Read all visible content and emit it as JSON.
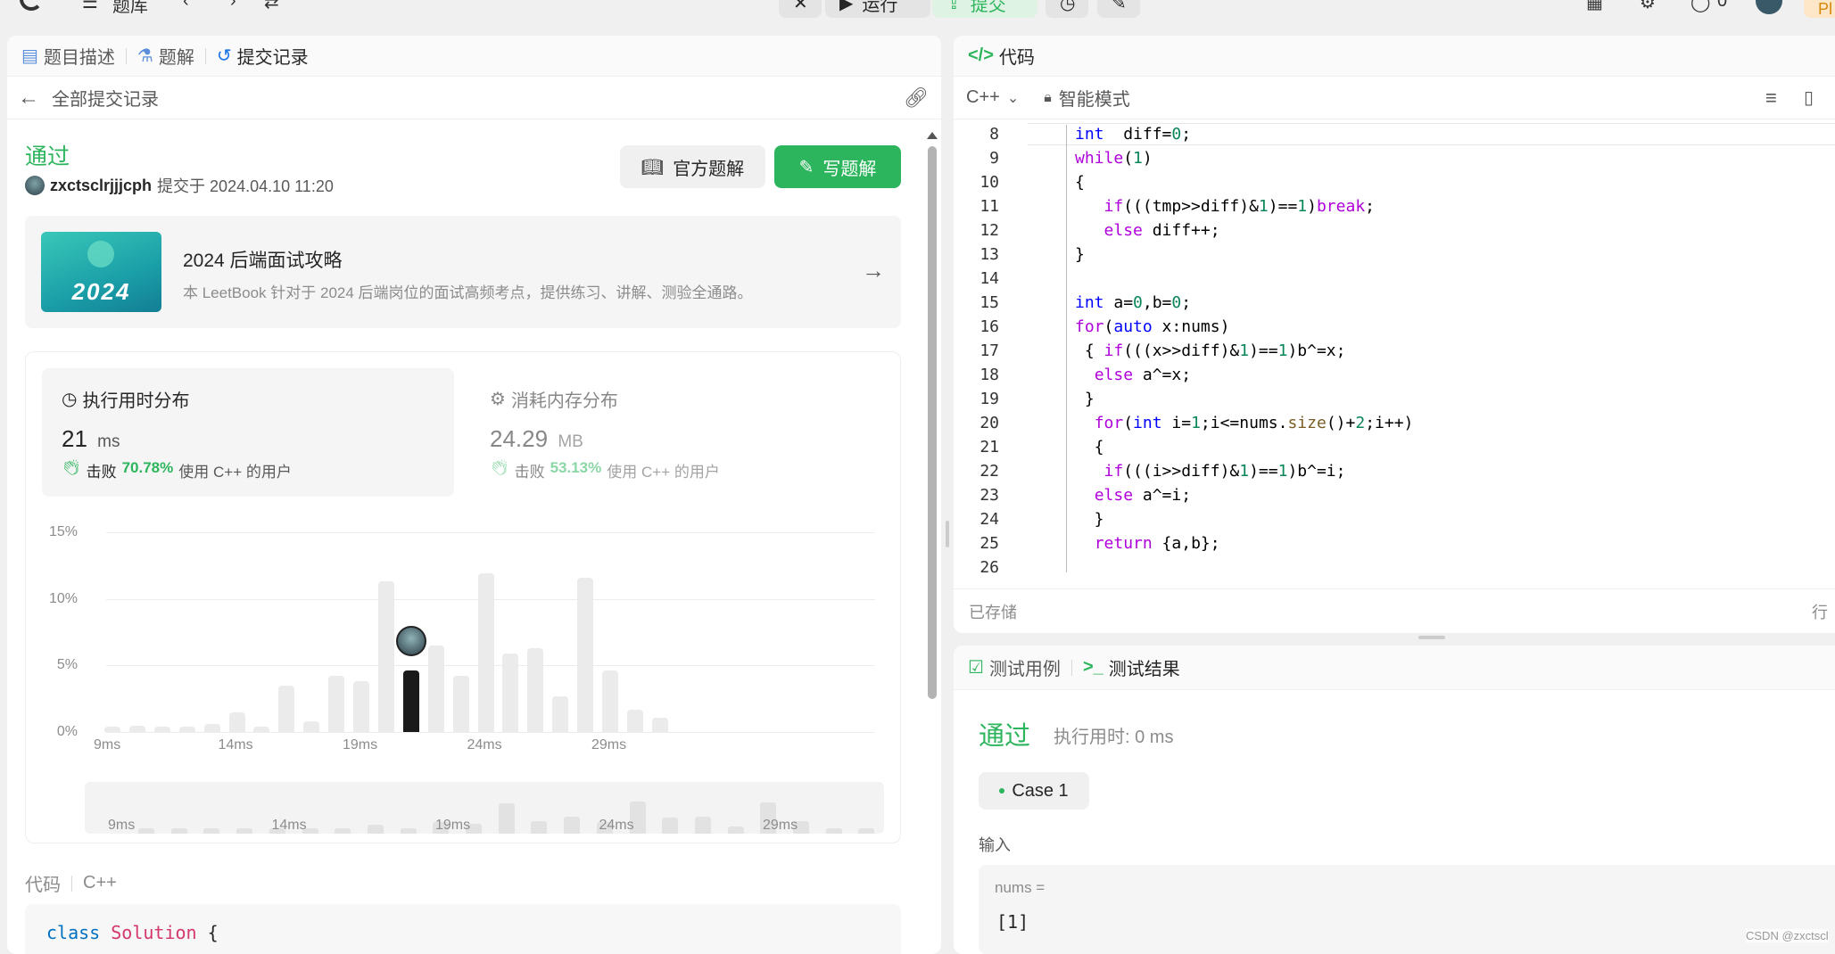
{
  "topbar": {
    "problem_list": "题库",
    "run": "运行",
    "submit": "提交",
    "counter": "0",
    "premium": "Pl"
  },
  "left": {
    "tabs": {
      "description": "题目描述",
      "solutions": "题解",
      "submissions": "提交记录"
    },
    "back_label": "全部提交记录",
    "status": "通过",
    "user": "zxctsclrjjjcph",
    "submitted_at": "提交于 2024.04.10 11:20",
    "official_solution": "官方题解",
    "write_solution": "写题解",
    "promo": {
      "badge": "2024",
      "title": "2024 后端面试攻略",
      "desc": "本 LeetBook 针对于 2024 后端岗位的面试高频考点，提供练习、讲解、测验全通路。"
    },
    "runtime": {
      "title": "执行用时分布",
      "value": "21",
      "unit": "ms",
      "beats_label": "击败",
      "beats_pct": "70.78%",
      "beats_suffix": "使用 C++ 的用户"
    },
    "memory": {
      "title": "消耗内存分布",
      "value": "24.29",
      "unit": "MB",
      "beats_label": "击败",
      "beats_pct": "53.13%",
      "beats_suffix": "使用 C++ 的用户"
    },
    "code_label": "代码",
    "code_lang": "C++",
    "code_preview": {
      "kw": "class",
      "name": "Solution",
      "brace": "{"
    }
  },
  "chart_data": {
    "type": "bar",
    "title": "",
    "xlabel": "",
    "ylabel": "",
    "y_ticks": [
      "15%",
      "10%",
      "5%",
      "0%"
    ],
    "ylim": [
      0,
      15
    ],
    "x_ticks": [
      "9ms",
      "14ms",
      "19ms",
      "24ms",
      "29ms"
    ],
    "categories": [
      "9ms",
      "10ms",
      "11ms",
      "12ms",
      "13ms",
      "14ms",
      "15ms",
      "16ms",
      "17ms",
      "18ms",
      "19ms",
      "20ms",
      "21ms",
      "22ms",
      "23ms",
      "24ms",
      "25ms",
      "26ms",
      "27ms",
      "28ms",
      "29ms",
      "30ms",
      "31ms",
      "32ms"
    ],
    "values": [
      0.4,
      0.5,
      0.4,
      0.4,
      0.6,
      1.5,
      0.4,
      3.5,
      0.8,
      4.2,
      3.8,
      11.3,
      4.6,
      6.5,
      4.2,
      11.9,
      5.9,
      6.3,
      2.7,
      11.6,
      4.6,
      1.7,
      1.1,
      0
    ],
    "highlight_category": "21ms",
    "grid": true
  },
  "editor": {
    "title": "代码",
    "lang": "C++",
    "mode": "智能模式",
    "status": "已存储",
    "cursor_hint": "行",
    "start_line": 8,
    "lines": [
      [
        [
          "kw",
          "int"
        ],
        [
          "",
          "  diff="
        ],
        [
          "nm",
          "0"
        ],
        [
          "",
          ";"
        ]
      ],
      [
        [
          "kp",
          "while"
        ],
        [
          "",
          "("
        ],
        [
          "nm",
          "1"
        ],
        [
          "",
          ")"
        ]
      ],
      [
        [
          "",
          "{"
        ]
      ],
      [
        [
          "",
          "   "
        ],
        [
          "kp",
          "if"
        ],
        [
          "",
          "(((tmp>>diff)&"
        ],
        [
          "nm",
          "1"
        ],
        [
          "",
          ")=="
        ],
        [
          "nm",
          "1"
        ],
        [
          "",
          ")"
        ],
        [
          "kp",
          "break"
        ],
        [
          "",
          ";"
        ]
      ],
      [
        [
          "",
          "   "
        ],
        [
          "kp",
          "else"
        ],
        [
          "",
          " diff++;"
        ]
      ],
      [
        [
          "",
          "}"
        ]
      ],
      [
        [
          "",
          ""
        ]
      ],
      [
        [
          "kw",
          "int"
        ],
        [
          "",
          " a="
        ],
        [
          "nm",
          "0"
        ],
        [
          "",
          ",b="
        ],
        [
          "nm",
          "0"
        ],
        [
          "",
          ";"
        ]
      ],
      [
        [
          "kp",
          "for"
        ],
        [
          "",
          "("
        ],
        [
          "kw",
          "auto"
        ],
        [
          "",
          " x:nums)"
        ]
      ],
      [
        [
          "",
          " { "
        ],
        [
          "kp",
          "if"
        ],
        [
          "",
          "(((x>>diff)&"
        ],
        [
          "nm",
          "1"
        ],
        [
          "",
          ")=="
        ],
        [
          "nm",
          "1"
        ],
        [
          "",
          ")b^=x;"
        ]
      ],
      [
        [
          "",
          "  "
        ],
        [
          "kp",
          "else"
        ],
        [
          "",
          " a^=x;"
        ]
      ],
      [
        [
          "",
          " }"
        ]
      ],
      [
        [
          "",
          "  "
        ],
        [
          "kp",
          "for"
        ],
        [
          "",
          "("
        ],
        [
          "kw",
          "int"
        ],
        [
          "",
          " i="
        ],
        [
          "nm",
          "1"
        ],
        [
          "",
          ";i<=nums."
        ],
        [
          "fn",
          "size"
        ],
        [
          "",
          "()+"
        ],
        [
          "nm",
          "2"
        ],
        [
          "",
          ";i++)"
        ]
      ],
      [
        [
          "",
          "  {"
        ]
      ],
      [
        [
          "",
          "   "
        ],
        [
          "kp",
          "if"
        ],
        [
          "",
          "(((i>>diff)&"
        ],
        [
          "nm",
          "1"
        ],
        [
          "",
          ")=="
        ],
        [
          "nm",
          "1"
        ],
        [
          "",
          ")b^=i;"
        ]
      ],
      [
        [
          "",
          "  "
        ],
        [
          "kp",
          "else"
        ],
        [
          "",
          " a^=i;"
        ]
      ],
      [
        [
          "",
          "  }"
        ]
      ],
      [
        [
          "",
          "  "
        ],
        [
          "kp",
          "return"
        ],
        [
          "",
          " {a,b};"
        ]
      ],
      [
        [
          "",
          ""
        ]
      ]
    ]
  },
  "test": {
    "tab_cases": "测试用例",
    "tab_results": "测试结果",
    "status": "通过",
    "runtime": "执行用时: 0 ms",
    "case": "Case 1",
    "input_label": "输入",
    "var_name": "nums =",
    "var_value": "[1]"
  },
  "watermark": "CSDN @zxctscl"
}
